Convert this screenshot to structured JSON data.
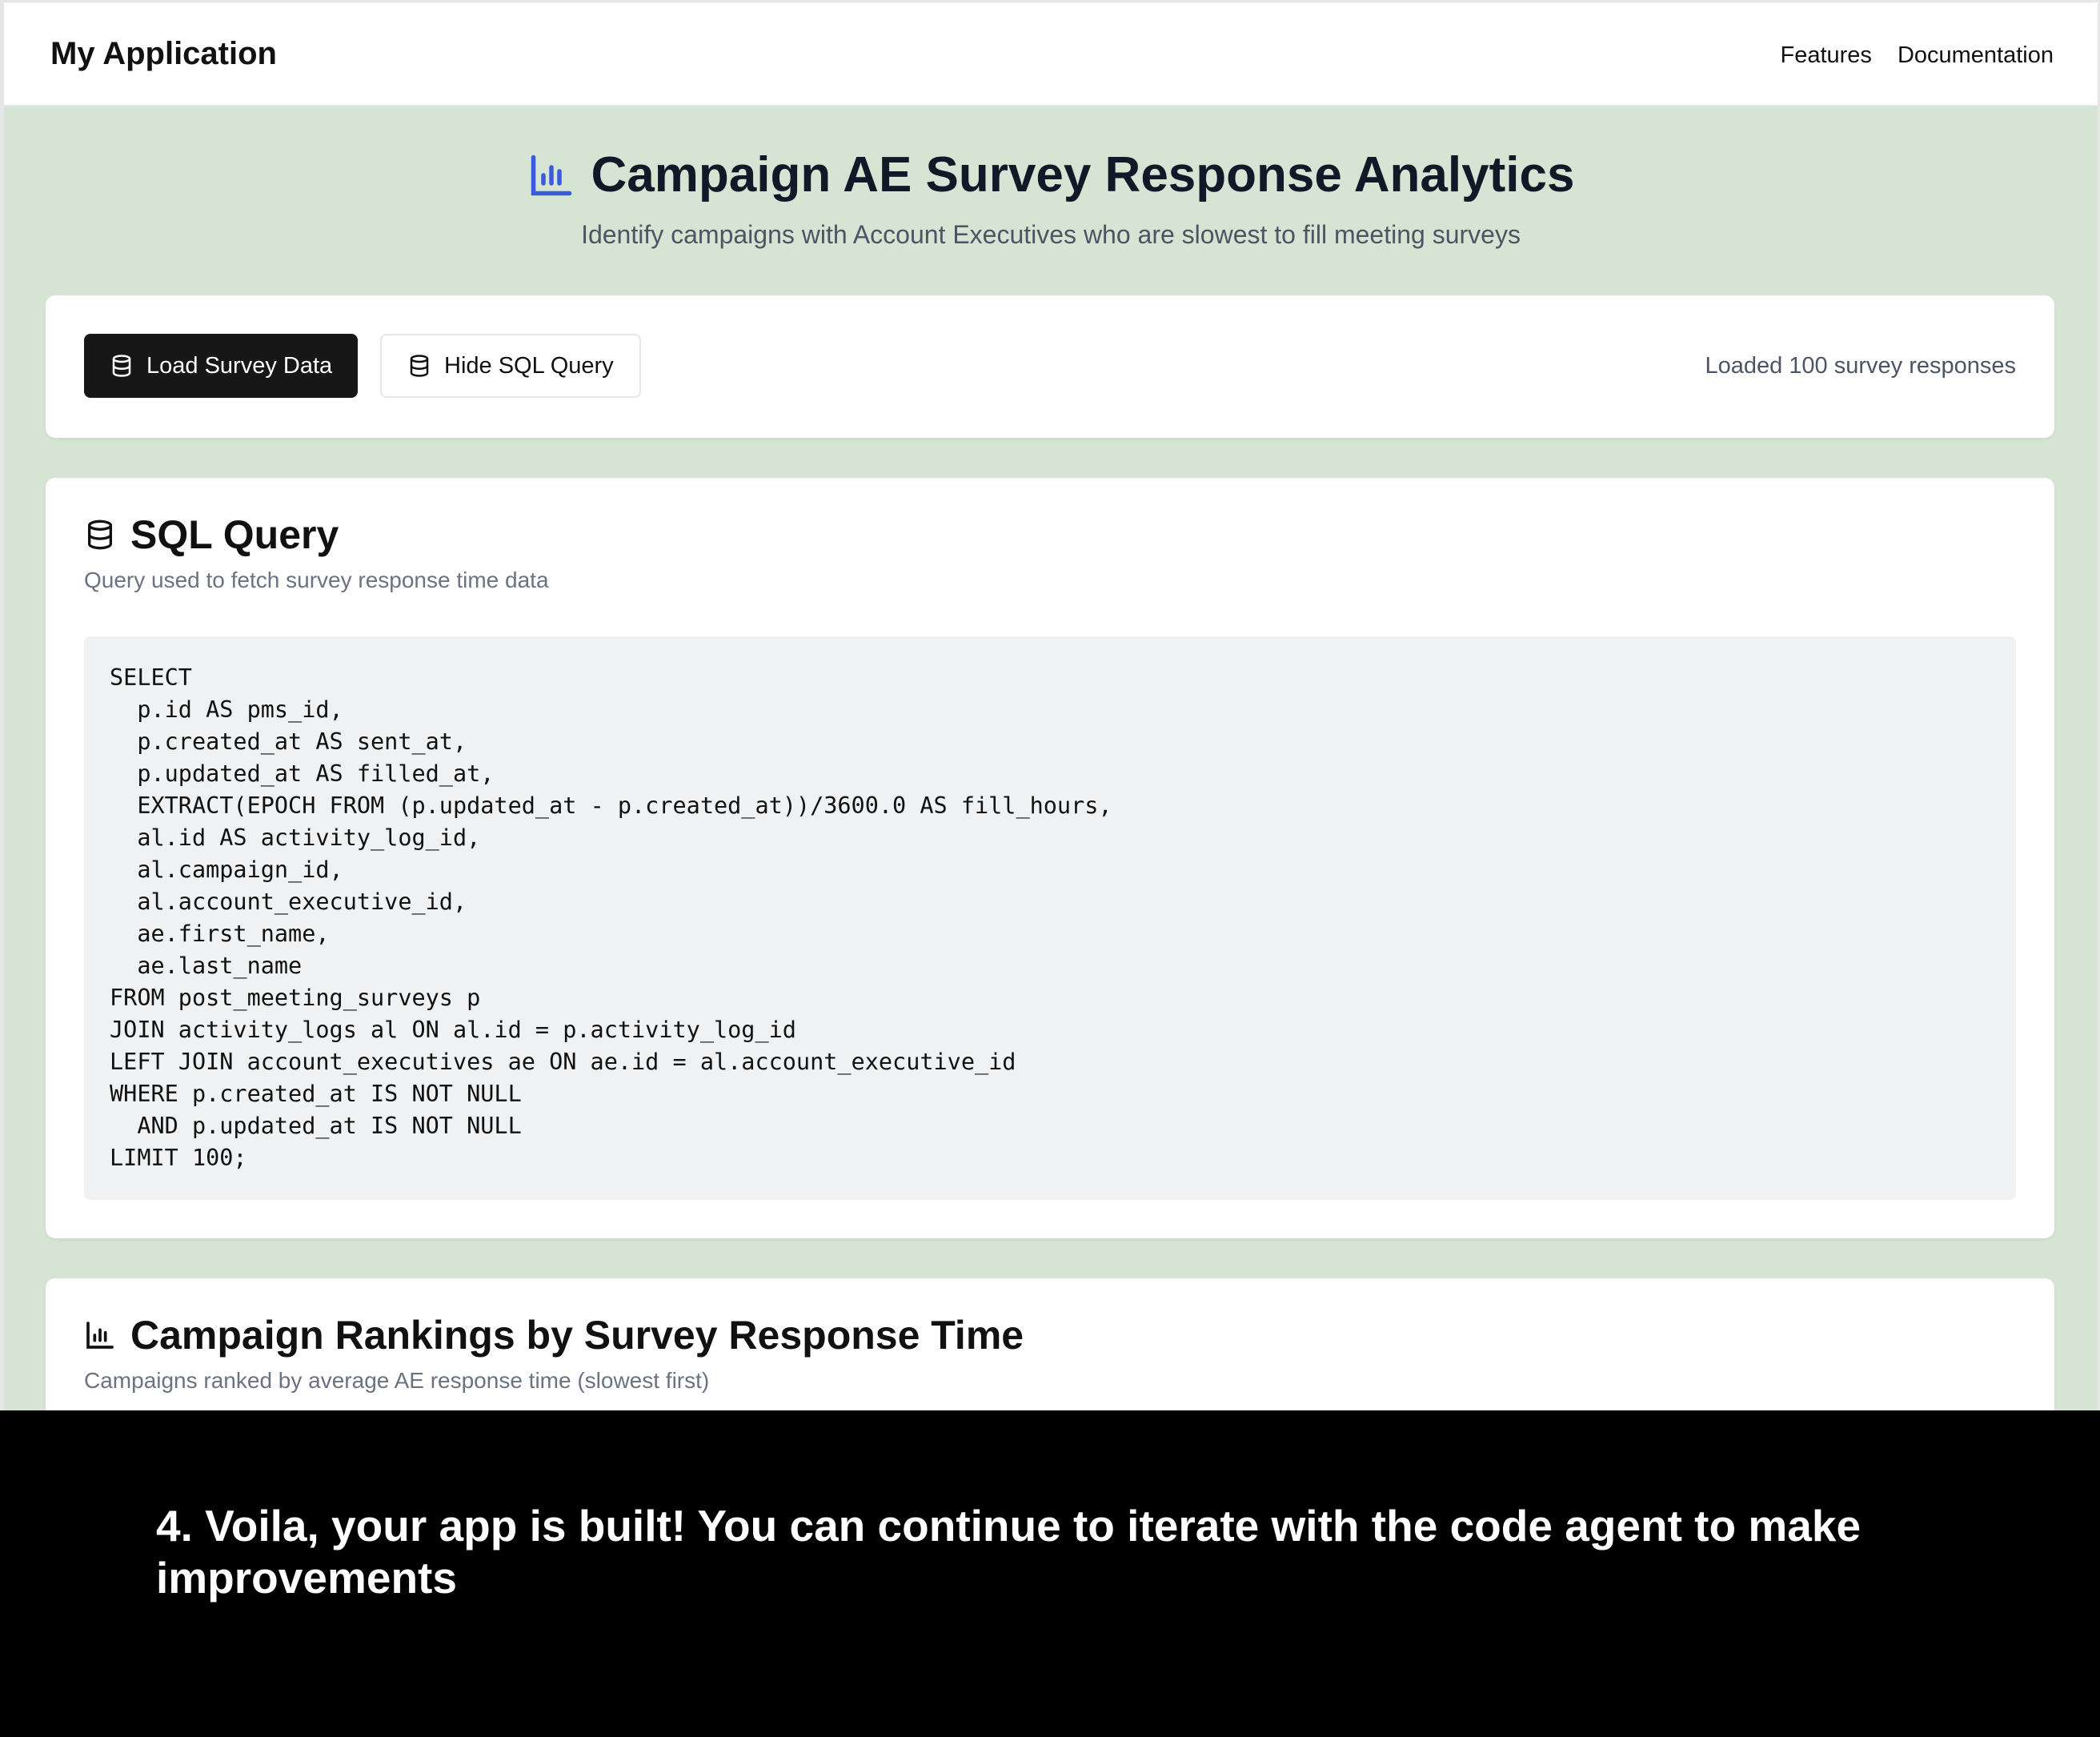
{
  "navbar": {
    "brand": "My Application",
    "links": [
      "Features",
      "Documentation"
    ]
  },
  "hero": {
    "title": "Campaign AE Survey Response Analytics",
    "subtitle": "Identify campaigns with Account Executives who are slowest to fill meeting surveys",
    "icon": "bar-chart-icon"
  },
  "toolbar": {
    "load_label": "Load Survey Data",
    "toggle_sql_label": "Hide SQL Query",
    "status": "Loaded 100 survey responses"
  },
  "sql_card": {
    "title": "SQL Query",
    "description": "Query used to fetch survey response time data",
    "query": "SELECT\n  p.id AS pms_id,\n  p.created_at AS sent_at,\n  p.updated_at AS filled_at,\n  EXTRACT(EPOCH FROM (p.updated_at - p.created_at))/3600.0 AS fill_hours,\n  al.id AS activity_log_id,\n  al.campaign_id,\n  al.account_executive_id,\n  ae.first_name,\n  ae.last_name\nFROM post_meeting_surveys p\nJOIN activity_logs al ON al.id = p.activity_log_id\nLEFT JOIN account_executives ae ON ae.id = al.account_executive_id\nWHERE p.created_at IS NOT NULL\n  AND p.updated_at IS NOT NULL\nLIMIT 100;"
  },
  "rank_card": {
    "title": "Campaign Rankings by Survey Response Time",
    "description": "Campaigns ranked by average AE response time (slowest first)"
  },
  "caption": "4. Voila, your app is built! You can continue to iterate with the code agent to make improvements",
  "colors": {
    "background": "#d5e4d3",
    "accent": "#3b5bdb",
    "primary_button": "#171717",
    "code_bg": "#f0f1f2"
  }
}
